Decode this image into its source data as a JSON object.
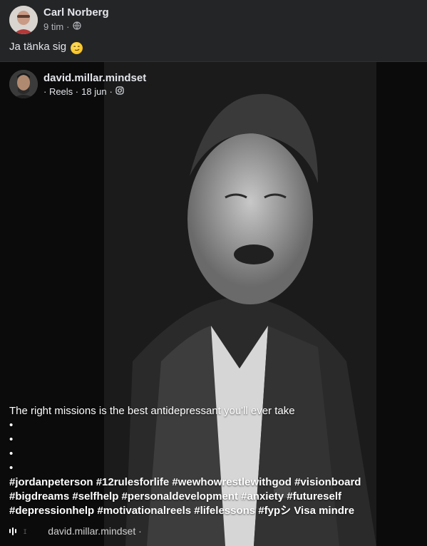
{
  "sharer": {
    "name": "Carl Norberg",
    "time": "9 tim",
    "separator": "·",
    "privacy_icon": "globe-icon"
  },
  "post": {
    "text": "Ja tänka sig",
    "emoji": "smirk-emoji"
  },
  "reel": {
    "author": "david.millar.mindset",
    "meta_prefix": "· Reels ·",
    "date": "18 jun",
    "meta_suffix": "·",
    "platform_icon": "instagram-icon",
    "caption_line": "The right missions is the best antidepressant you'll ever take",
    "bullets": [
      "•",
      "•",
      "•",
      "•"
    ],
    "hashtags_1": "#jordanpeterson #12rulesforlife #wewhowrestlewithgod #visionboard",
    "hashtags_2": "#bigdreams #selfhelp #personaldevelopment #anxiety #futureself",
    "hashtags_3": "#depressionhelp #motivationalreels #lifelessons #fypシ",
    "see_less": "Visa mindre",
    "audio_author": "david.millar.mindset ·"
  }
}
